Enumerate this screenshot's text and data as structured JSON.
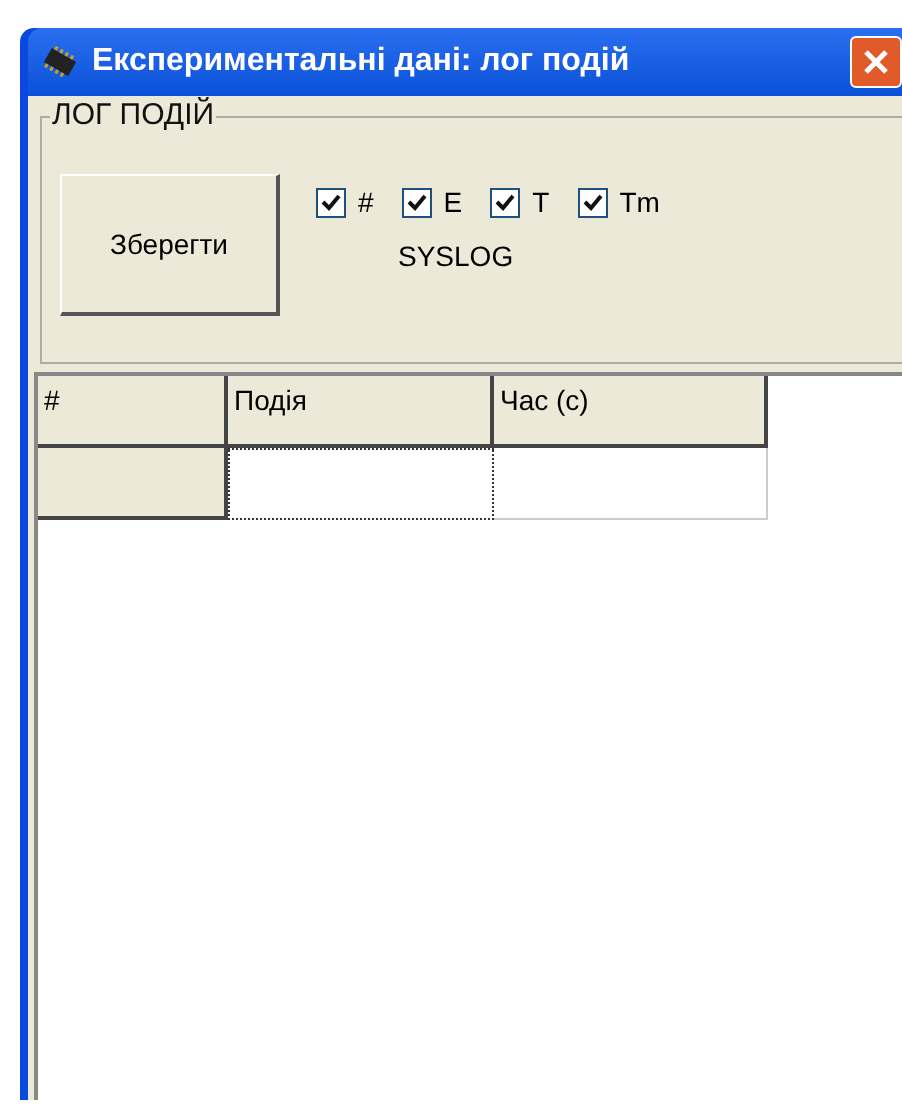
{
  "window": {
    "title": "Експериментальні дані: лог подій"
  },
  "group": {
    "title": "ЛОГ ПОДІЙ"
  },
  "save_button": {
    "label": "Зберегти"
  },
  "checkboxes": [
    {
      "label": "#",
      "checked": true
    },
    {
      "label": "E",
      "checked": true
    },
    {
      "label": "T",
      "checked": true
    },
    {
      "label": "Tm",
      "checked": true
    }
  ],
  "syslog_label": "SYSLOG",
  "table": {
    "columns": [
      "#",
      "Подія",
      "Час (с)"
    ],
    "rows": [
      {
        "cells": [
          {
            "selected": true
          },
          {
            "selected": false
          }
        ]
      }
    ]
  }
}
